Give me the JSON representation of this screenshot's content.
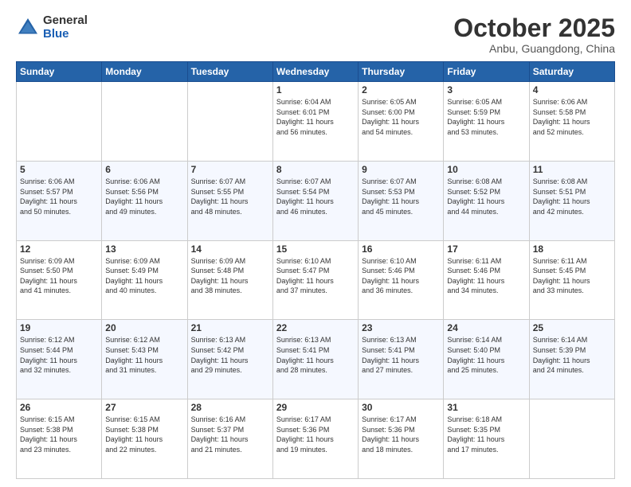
{
  "header": {
    "logo_general": "General",
    "logo_blue": "Blue",
    "month": "October 2025",
    "location": "Anbu, Guangdong, China"
  },
  "days_of_week": [
    "Sunday",
    "Monday",
    "Tuesday",
    "Wednesday",
    "Thursday",
    "Friday",
    "Saturday"
  ],
  "weeks": [
    [
      {
        "day": "",
        "info": ""
      },
      {
        "day": "",
        "info": ""
      },
      {
        "day": "",
        "info": ""
      },
      {
        "day": "1",
        "info": "Sunrise: 6:04 AM\nSunset: 6:01 PM\nDaylight: 11 hours\nand 56 minutes."
      },
      {
        "day": "2",
        "info": "Sunrise: 6:05 AM\nSunset: 6:00 PM\nDaylight: 11 hours\nand 54 minutes."
      },
      {
        "day": "3",
        "info": "Sunrise: 6:05 AM\nSunset: 5:59 PM\nDaylight: 11 hours\nand 53 minutes."
      },
      {
        "day": "4",
        "info": "Sunrise: 6:06 AM\nSunset: 5:58 PM\nDaylight: 11 hours\nand 52 minutes."
      }
    ],
    [
      {
        "day": "5",
        "info": "Sunrise: 6:06 AM\nSunset: 5:57 PM\nDaylight: 11 hours\nand 50 minutes."
      },
      {
        "day": "6",
        "info": "Sunrise: 6:06 AM\nSunset: 5:56 PM\nDaylight: 11 hours\nand 49 minutes."
      },
      {
        "day": "7",
        "info": "Sunrise: 6:07 AM\nSunset: 5:55 PM\nDaylight: 11 hours\nand 48 minutes."
      },
      {
        "day": "8",
        "info": "Sunrise: 6:07 AM\nSunset: 5:54 PM\nDaylight: 11 hours\nand 46 minutes."
      },
      {
        "day": "9",
        "info": "Sunrise: 6:07 AM\nSunset: 5:53 PM\nDaylight: 11 hours\nand 45 minutes."
      },
      {
        "day": "10",
        "info": "Sunrise: 6:08 AM\nSunset: 5:52 PM\nDaylight: 11 hours\nand 44 minutes."
      },
      {
        "day": "11",
        "info": "Sunrise: 6:08 AM\nSunset: 5:51 PM\nDaylight: 11 hours\nand 42 minutes."
      }
    ],
    [
      {
        "day": "12",
        "info": "Sunrise: 6:09 AM\nSunset: 5:50 PM\nDaylight: 11 hours\nand 41 minutes."
      },
      {
        "day": "13",
        "info": "Sunrise: 6:09 AM\nSunset: 5:49 PM\nDaylight: 11 hours\nand 40 minutes."
      },
      {
        "day": "14",
        "info": "Sunrise: 6:09 AM\nSunset: 5:48 PM\nDaylight: 11 hours\nand 38 minutes."
      },
      {
        "day": "15",
        "info": "Sunrise: 6:10 AM\nSunset: 5:47 PM\nDaylight: 11 hours\nand 37 minutes."
      },
      {
        "day": "16",
        "info": "Sunrise: 6:10 AM\nSunset: 5:46 PM\nDaylight: 11 hours\nand 36 minutes."
      },
      {
        "day": "17",
        "info": "Sunrise: 6:11 AM\nSunset: 5:46 PM\nDaylight: 11 hours\nand 34 minutes."
      },
      {
        "day": "18",
        "info": "Sunrise: 6:11 AM\nSunset: 5:45 PM\nDaylight: 11 hours\nand 33 minutes."
      }
    ],
    [
      {
        "day": "19",
        "info": "Sunrise: 6:12 AM\nSunset: 5:44 PM\nDaylight: 11 hours\nand 32 minutes."
      },
      {
        "day": "20",
        "info": "Sunrise: 6:12 AM\nSunset: 5:43 PM\nDaylight: 11 hours\nand 31 minutes."
      },
      {
        "day": "21",
        "info": "Sunrise: 6:13 AM\nSunset: 5:42 PM\nDaylight: 11 hours\nand 29 minutes."
      },
      {
        "day": "22",
        "info": "Sunrise: 6:13 AM\nSunset: 5:41 PM\nDaylight: 11 hours\nand 28 minutes."
      },
      {
        "day": "23",
        "info": "Sunrise: 6:13 AM\nSunset: 5:41 PM\nDaylight: 11 hours\nand 27 minutes."
      },
      {
        "day": "24",
        "info": "Sunrise: 6:14 AM\nSunset: 5:40 PM\nDaylight: 11 hours\nand 25 minutes."
      },
      {
        "day": "25",
        "info": "Sunrise: 6:14 AM\nSunset: 5:39 PM\nDaylight: 11 hours\nand 24 minutes."
      }
    ],
    [
      {
        "day": "26",
        "info": "Sunrise: 6:15 AM\nSunset: 5:38 PM\nDaylight: 11 hours\nand 23 minutes."
      },
      {
        "day": "27",
        "info": "Sunrise: 6:15 AM\nSunset: 5:38 PM\nDaylight: 11 hours\nand 22 minutes."
      },
      {
        "day": "28",
        "info": "Sunrise: 6:16 AM\nSunset: 5:37 PM\nDaylight: 11 hours\nand 21 minutes."
      },
      {
        "day": "29",
        "info": "Sunrise: 6:17 AM\nSunset: 5:36 PM\nDaylight: 11 hours\nand 19 minutes."
      },
      {
        "day": "30",
        "info": "Sunrise: 6:17 AM\nSunset: 5:36 PM\nDaylight: 11 hours\nand 18 minutes."
      },
      {
        "day": "31",
        "info": "Sunrise: 6:18 AM\nSunset: 5:35 PM\nDaylight: 11 hours\nand 17 minutes."
      },
      {
        "day": "",
        "info": ""
      }
    ]
  ]
}
